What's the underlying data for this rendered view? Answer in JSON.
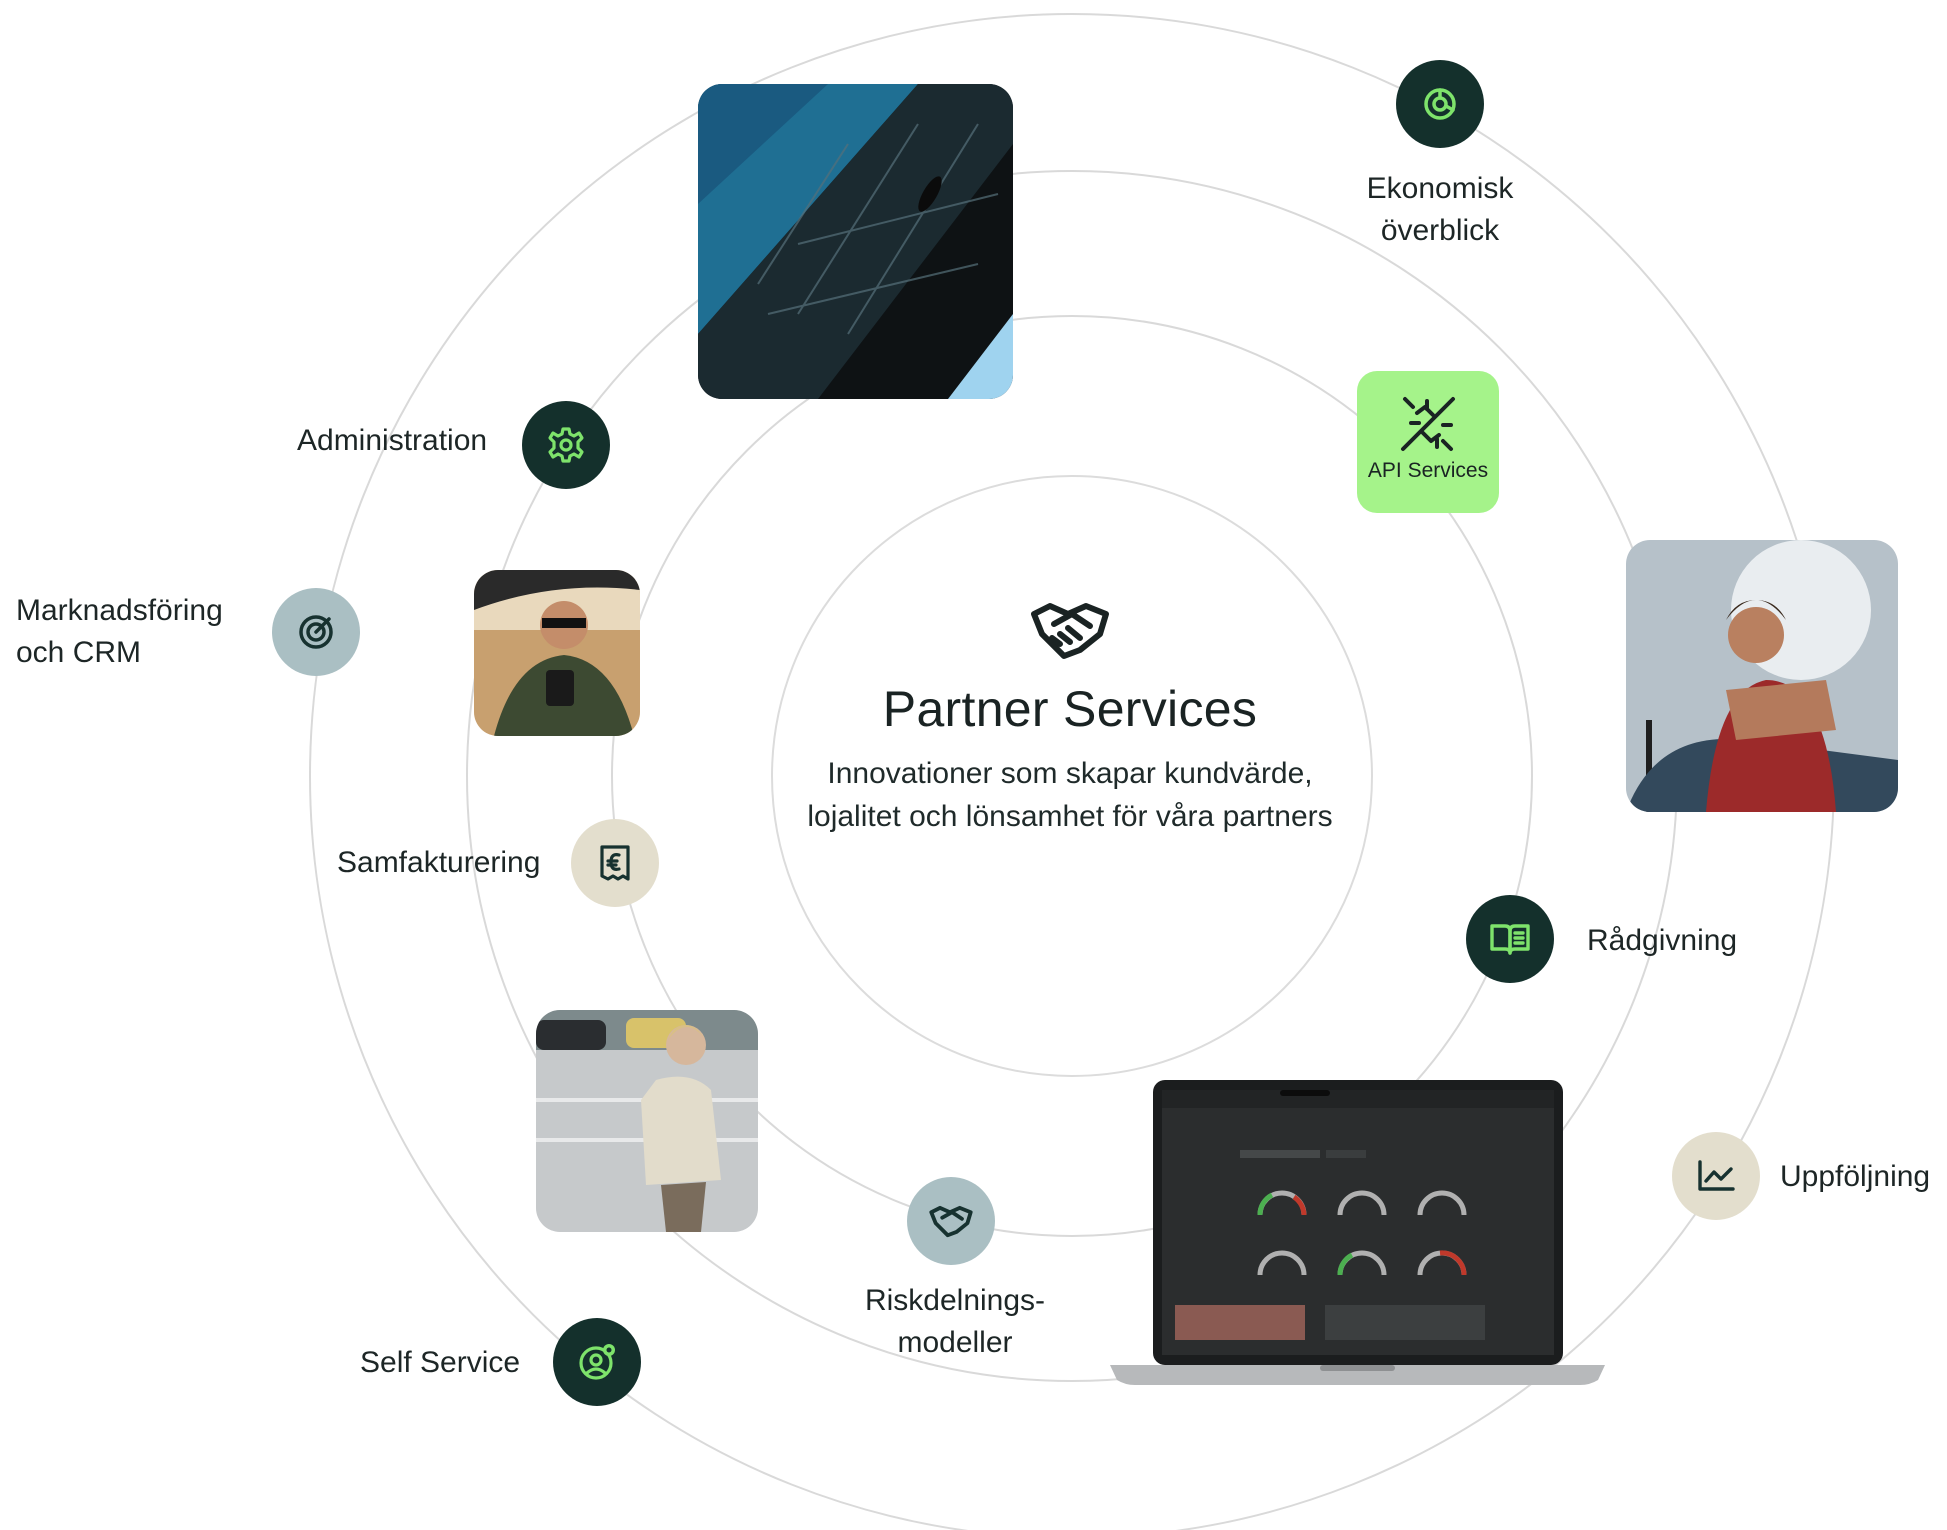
{
  "center": {
    "title": "Partner Services",
    "subtitle": "Innovationer som skapar kundvärde, lojalitet och lönsamhet för våra partners"
  },
  "services": {
    "ekonomisk": {
      "label": "Ekonomisk överblick",
      "icon": "chart-pie-icon"
    },
    "administration": {
      "label": "Administration",
      "icon": "gear-icon"
    },
    "marknadsforing": {
      "label": "Marknadsföring och CRM",
      "icon": "target-icon"
    },
    "samfakturering": {
      "label": "Samfakturering",
      "icon": "invoice-icon"
    },
    "self_service": {
      "label": "Self Service",
      "icon": "user-gear-icon"
    },
    "riskdelning": {
      "label": "Riskdelnings- modeller",
      "icon": "handshake-icon"
    },
    "api": {
      "label": "API Services",
      "icon": "plug-disconnect-icon"
    },
    "radgivning": {
      "label": "Rådgivning",
      "icon": "book-icon"
    },
    "uppfoljning": {
      "label": "Uppföljning",
      "icon": "line-chart-icon"
    }
  },
  "colors": {
    "dark_badge": "#14302c",
    "icon_green": "#7ee36b",
    "teal_badge": "#aabfc3",
    "sand_badge": "#e3decd",
    "api_green": "#a5f38a",
    "ring": "#d9d9d9"
  }
}
